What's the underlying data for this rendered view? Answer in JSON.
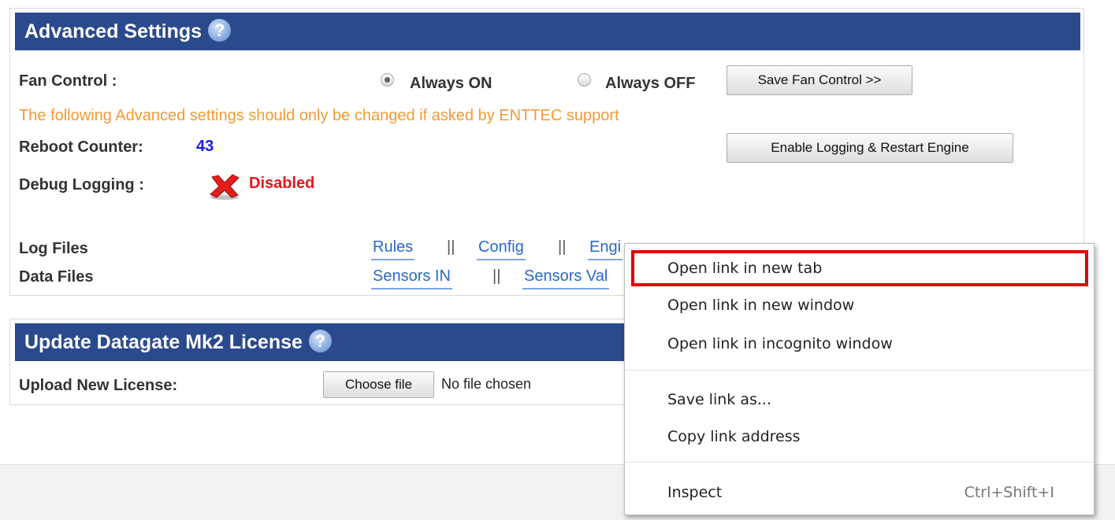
{
  "advanced": {
    "title": "Advanced Settings",
    "help_glyph": "?",
    "fan_label": "Fan Control :",
    "radio_on": "Always ON",
    "radio_off": "Always OFF",
    "fan_selected": "Always ON",
    "save_fan": "Save Fan Control >>",
    "warning": "The following Advanced settings should only be changed if asked by ENTTEC support",
    "reboot_label": "Reboot Counter:",
    "reboot_value": "43",
    "enable_logging": "Enable Logging & Restart Engine",
    "debug_label": "Debug Logging :",
    "debug_status": "Disabled",
    "log_files_label": "Log Files",
    "data_files_label": "Data Files",
    "log_links": [
      "Rules",
      "Config",
      "Engi"
    ],
    "data_links": [
      "Sensors IN",
      "Sensors Val"
    ],
    "separator": "||"
  },
  "license": {
    "title": "Update Datagate Mk2 License",
    "help_glyph": "?",
    "upload_label": "Upload New License:",
    "choose_file": "Choose file",
    "no_file": "No file chosen"
  },
  "context_menu": {
    "items": [
      "Open link in new tab",
      "Open link in new window",
      "Open link in incognito window",
      "Save link as...",
      "Copy link address",
      "Inspect"
    ],
    "inspect_shortcut": "Ctrl+Shift+I",
    "highlighted_item": "Open link in new tab"
  },
  "colors": {
    "header_bg": "#2b4a8d",
    "warning": "#f39a34",
    "reboot_value": "#1a1ae6",
    "disabled": "#e8151b",
    "link": "#2a68c9",
    "highlight_border": "#e00000"
  },
  "icons": {
    "help": "question-circle-icon",
    "debug_status": "red-x-icon"
  }
}
